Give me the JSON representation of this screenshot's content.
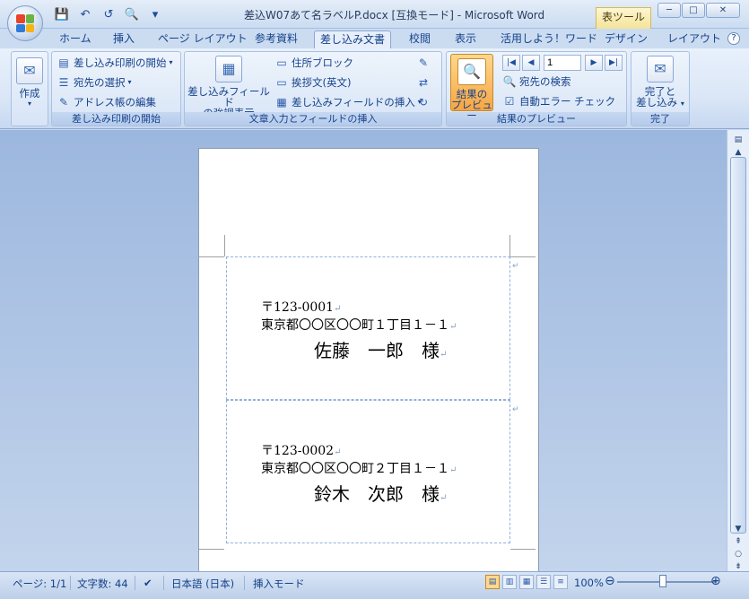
{
  "title_bar": {
    "document_title": "差込W07あて名ラベルP.docx [互換モード] - Microsoft Word",
    "contextual_tab": "表ツール",
    "minimize": "─",
    "maximize": "□",
    "close": "✕"
  },
  "quick_access": {
    "save": "💾",
    "undo": "↶",
    "redo": "↺",
    "print_preview": "🔍",
    "customize": "▾"
  },
  "tabs": [
    "ホーム",
    "挿入",
    "ページ レイアウト",
    "参考資料",
    "差し込み文書",
    "校閲",
    "表示",
    "活用しよう！ワード",
    "デザイン",
    "レイアウト"
  ],
  "active_tab": "差し込み文書",
  "help": "?",
  "ribbon": {
    "create": {
      "label": "作成"
    },
    "start_group": {
      "label": "差し込み印刷の開始",
      "start_merge": "差し込み印刷の開始",
      "select_recipients": "宛先の選択",
      "edit_recipients": "アドレス帳の編集"
    },
    "write_group": {
      "label": "文章入力とフィールドの挿入",
      "highlight_line1": "差し込みフィールド",
      "highlight_line2": "の強調表示",
      "address_block": "住所ブロック",
      "greeting_line": "挨拶文(英文)",
      "insert_field": "差し込みフィールドの挿入"
    },
    "preview_group": {
      "label": "結果のプレビュー",
      "preview_line1": "結果の",
      "preview_line2": "プレビュー",
      "record_number": "1",
      "find_recipient": "宛先の検索",
      "auto_check": "自動エラー チェック"
    },
    "finish_group": {
      "label": "完了",
      "finish_line1": "完了と",
      "finish_line2": "差し込み"
    }
  },
  "document": {
    "labels": [
      {
        "postal": "〒123-0001",
        "address": "東京都〇〇区〇〇町１丁目１－１",
        "name": "佐藤　一郎　様"
      },
      {
        "postal": "〒123-0002",
        "address": "東京都〇〇区〇〇町２丁目１－１",
        "name": "鈴木　次郎　様"
      }
    ]
  },
  "status_bar": {
    "page": "ページ: 1/1",
    "word_count": "文字数: 44",
    "language": "日本語 (日本)",
    "mode": "挿入モード",
    "zoom": "100%"
  },
  "colors": {
    "office_logo": [
      "#e8432b",
      "#6ab344",
      "#f5b316",
      "#2f7ad8"
    ],
    "active_preview": "#f7a542"
  }
}
